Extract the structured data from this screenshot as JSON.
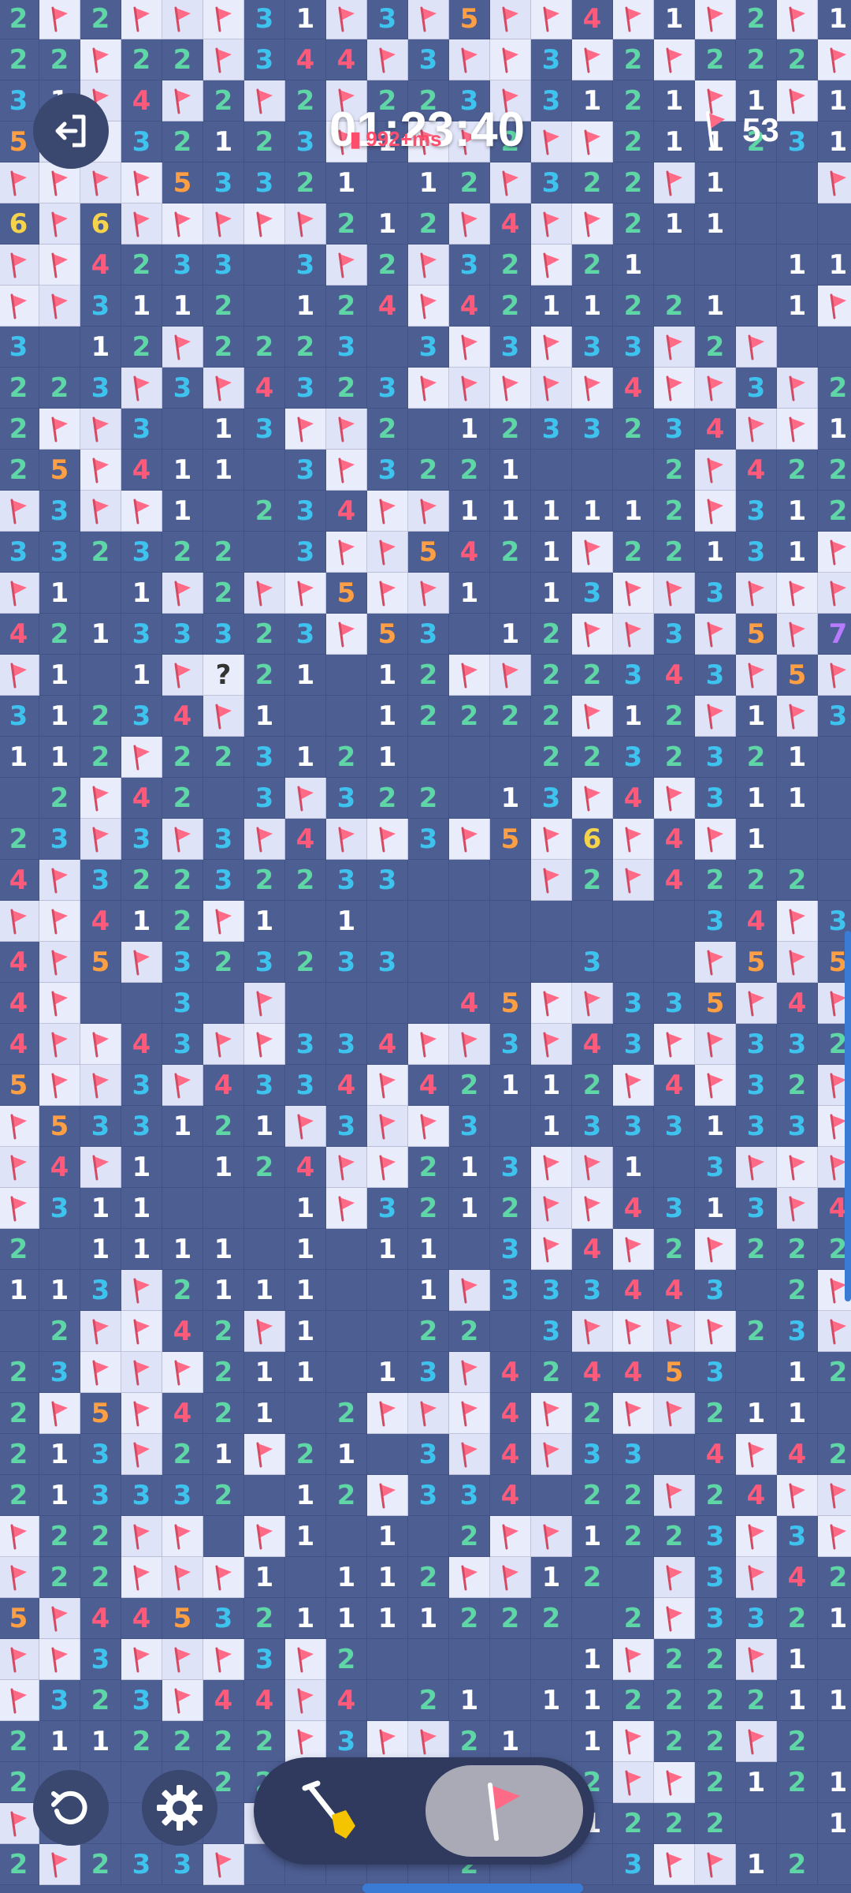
{
  "hud": {
    "timer": "01:23:40",
    "ping": "992+ms",
    "flags_remaining": "53"
  },
  "board": {
    "cols": 21,
    "rows": 46,
    "colors": {
      "1": "#ffffff",
      "2": "#5fd6a6",
      "3": "#3ec3ef",
      "4": "#ff5a7a",
      "5": "#ff9f43",
      "6": "#f5d34a",
      "7": "#b87bff",
      "?": "#333333"
    },
    "rows_data": [
      "2F2FFF31F3F5FF4F1F2F1",
      "22F22F344F3FF3F2F222F",
      "31F4F2F2F223F3121F1F1",
      "5FF32123F1FF2FF211231",
      "FFFF53321 12F322F1  F",
      "6F6FFFFF212F4FF211   ",
      "FF4233 3F2F32F21   11",
      "FF3112 124F4211221 1F",
      "3 12F2223 3F3F33F2F  ",
      "223F3F4323FFFFF4FF3F2",
      "2FF3 13FF2 1233234FF1",
      "25F411 3F3221   2F422",
      "F3FF1 234FF111112F312",
      "332322 3FF5421F22131F",
      "F1 1F2FF5FF1 13FF3FFF",
      "42133323F53 12FF3F5F7",
      "F1 1F?21 12FF22343F5F",
      "31234F1  12222F12F1F3",
      "112F223121   2232321 ",
      " 2F42 3F322 13F4F311 ",
      "23F3F3F4FF3F5F6F4F1  ",
      "4F32232233   F2F4222 ",
      "FF412F1 1        34F31",
      "4F5F323233    3  F5F5",
      "4F  3 F    45FF335F4F",
      "4FF43FF334FF3F43FF332",
      "5FF3F4334F42112F4F32F",
      "F533121F3FF3 1333133F",
      "F4F1 124FF213FF1 3FFF",
      "F311   1F3212FF4313F4",
      "2 1111 1 11 3F4F2F222",
      "113F2111  1F333443 2F",
      " 2FF42F1  22 3FFFF23F",
      "23FFF211 13F424453 12",
      "2F5F421 2FFF4F2FF211 ",
      "213F21F21 3F4F33 4F42",
      "213332 12F334 22F24FF",
      "F22FF F1 1 2FF1223F3F",
      "F22FFF1 112FF12 F3F42",
      "5F445321111222 2F3321",
      "FF3FFF3F2     1F22F1 ",
      "F323F44F4 21 11222211",
      "2112222F3FF21 1F22F2 ",
      "2   22222 2 F 2FF2121F",
      "F   2 F       1222  1 ",
      "2F233F     2   3FF12 "
    ]
  },
  "controls": {
    "dig_label": "dig",
    "flag_label": "flag"
  }
}
